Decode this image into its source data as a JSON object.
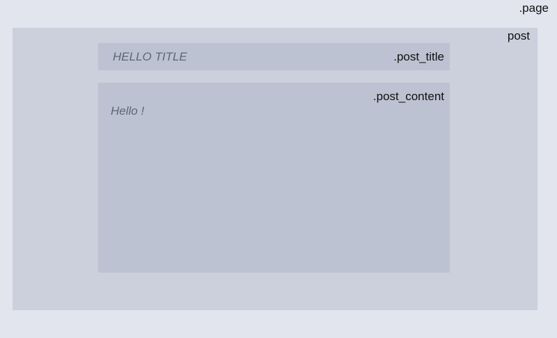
{
  "labels": {
    "page": ".page",
    "post": "post",
    "post_title": ".post_title",
    "post_content": ".post_content"
  },
  "post": {
    "title": "HELLO TITLE",
    "content": "Hello !"
  },
  "colors": {
    "page_background": "#e2e5ee",
    "post_background": "#ccd0dc",
    "block_background": "#bcc2d1",
    "content_text": "#5e6576",
    "label_text": "#111111"
  }
}
